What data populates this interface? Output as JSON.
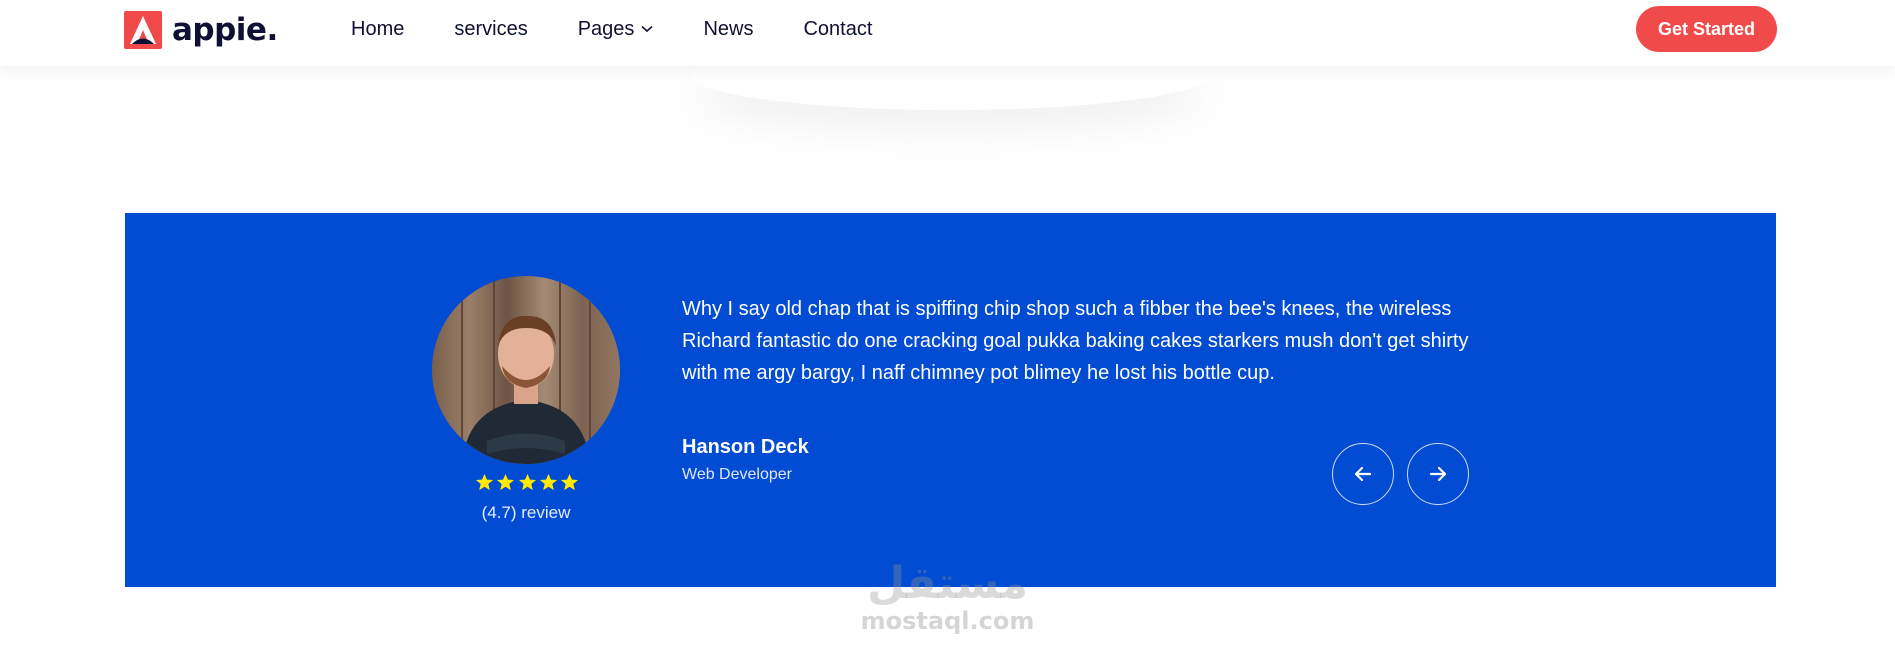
{
  "header": {
    "logo_text": "appie.",
    "nav": [
      {
        "label": "Home"
      },
      {
        "label": "services"
      },
      {
        "label": "Pages"
      },
      {
        "label": "News"
      },
      {
        "label": "Contact"
      }
    ],
    "cta_label": "Get Started"
  },
  "testimonial": {
    "quote": "Why I say old chap that is spiffing chip shop such a fibber the bee's knees, the wireless Richard fantastic do one cracking goal pukka baking cakes starkers mush don't get shirty with me argy bargy, I naff chimney pot blimey he lost his bottle cup.",
    "author_name": "Hanson Deck",
    "author_role": "Web Developer",
    "rating_stars": 5,
    "review_text": "(4.7) review"
  },
  "watermark": {
    "arabic": "مستقل",
    "latin": "mostaql.com"
  },
  "colors": {
    "brand_dark": "#0e1133",
    "cta_red": "#f04a4a",
    "panel_blue": "#014cd2",
    "star_yellow": "#ffea00"
  },
  "icons": [
    "logo-icon",
    "chevron-down-icon",
    "star-icon",
    "arrow-left-icon",
    "arrow-right-icon"
  ]
}
